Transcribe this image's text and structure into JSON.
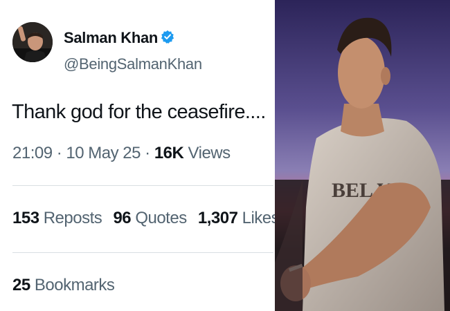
{
  "user": {
    "name": "Salman Khan",
    "handle": "@BeingSalmanKhan",
    "avatar_icon": "profile-photo-icon",
    "verified_icon": "verified-badge-icon",
    "verified_color": "#1d9bf0"
  },
  "post": {
    "text": "Thank god for the ceasefire....",
    "time": "21:09",
    "date": "10 May 25",
    "separator": "·",
    "views_count": "16K",
    "views_label": "Views"
  },
  "stats": {
    "reposts_count": "153",
    "reposts_label": "Reposts",
    "quotes_count": "96",
    "quotes_label": "Quotes",
    "likes_count": "1,307",
    "likes_label": "Likes",
    "bookmarks_count": "25",
    "bookmarks_label": "Bookmarks"
  },
  "photo": {
    "shirt_text": "BEL V"
  },
  "colors": {
    "text_primary": "#0f1419",
    "text_secondary": "#536471",
    "divider": "#d9dee2"
  }
}
